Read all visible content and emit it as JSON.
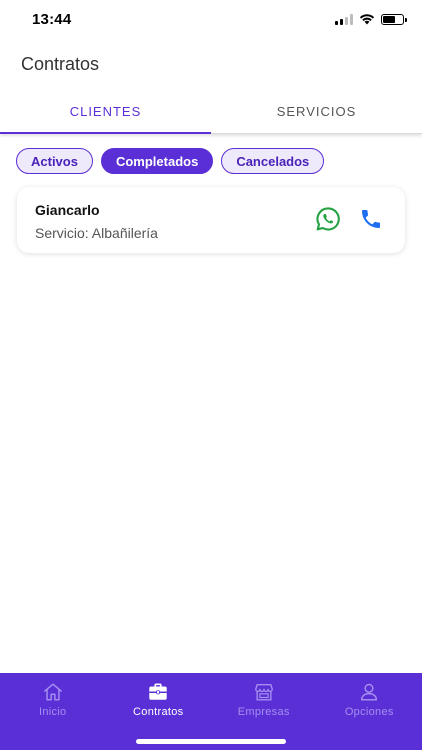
{
  "status_bar": {
    "time": "13:44"
  },
  "header": {
    "title": "Contratos"
  },
  "tabs": [
    {
      "label": "CLIENTES",
      "active": true
    },
    {
      "label": "SERVICIOS",
      "active": false
    }
  ],
  "filters": [
    {
      "label": "Activos",
      "selected": false
    },
    {
      "label": "Completados",
      "selected": true
    },
    {
      "label": "Cancelados",
      "selected": false
    }
  ],
  "contracts": [
    {
      "name": "Giancarlo",
      "service": "Servicio: Albañilería",
      "actions": [
        "whatsapp-icon",
        "phone-icon"
      ]
    }
  ],
  "bottom_nav": [
    {
      "label": "Inicio",
      "icon": "home-icon",
      "active": false
    },
    {
      "label": "Contratos",
      "icon": "briefcase-icon",
      "active": true
    },
    {
      "label": "Empresas",
      "icon": "store-icon",
      "active": false
    },
    {
      "label": "Opciones",
      "icon": "user-icon",
      "active": false
    }
  ],
  "colors": {
    "accent": "#5b2fd6",
    "chip_bg": "#efe9fc",
    "whatsapp": "#25a244",
    "phone": "#1e6ef0",
    "nav_inactive": "#a58ef0"
  }
}
